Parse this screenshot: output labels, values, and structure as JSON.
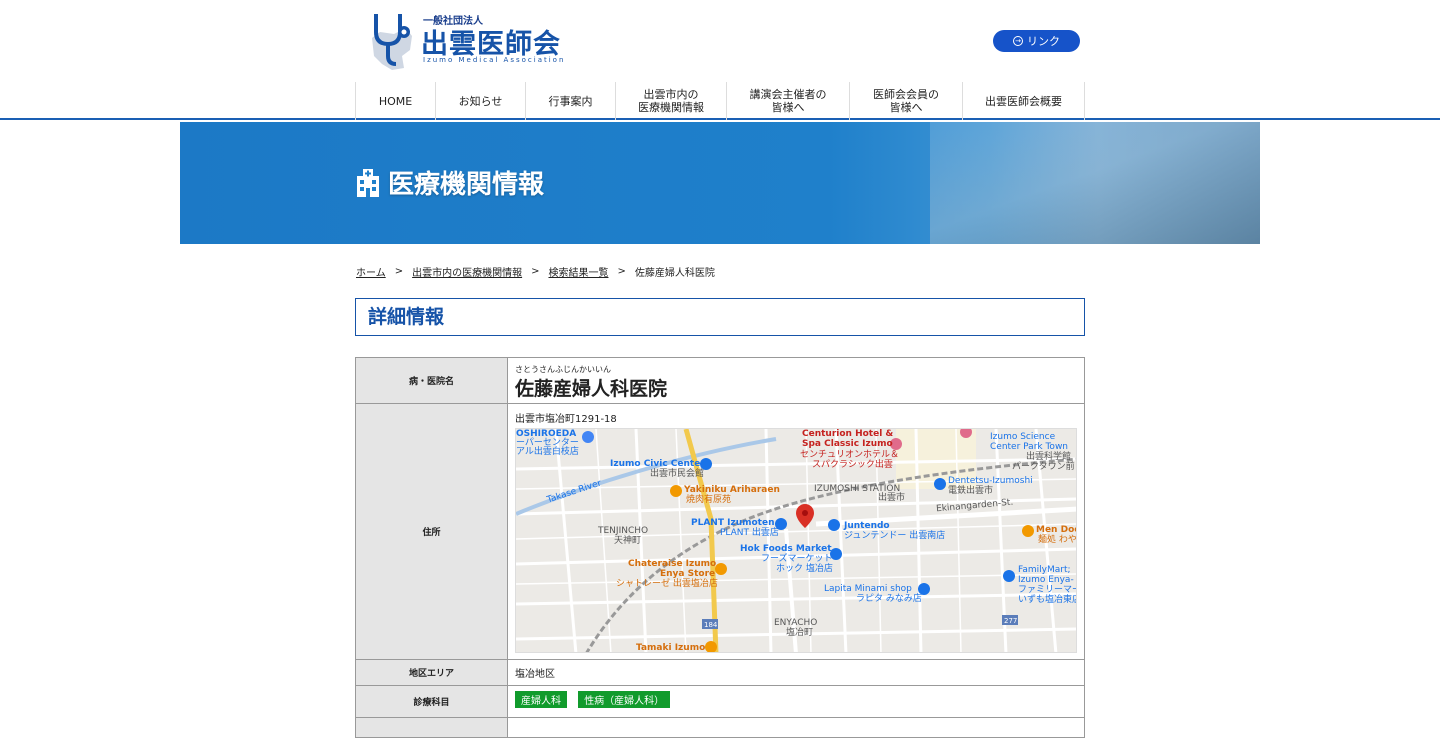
{
  "header": {
    "org_type": "一般社団法人",
    "org_name": "出雲医師会",
    "org_name_en": "Izumo Medical Association",
    "link_label": "リンク"
  },
  "nav": [
    {
      "label": "HOME",
      "width": 80
    },
    {
      "label": "お知らせ",
      "width": 90
    },
    {
      "label": "行事案内",
      "width": 90
    },
    {
      "label": "出雲市内の\n医療機関情報",
      "width": 111
    },
    {
      "label": "講演会主催者の\n皆様へ",
      "width": 123
    },
    {
      "label": "医師会会員の\n皆様へ",
      "width": 113
    },
    {
      "label": "出雲医師会概要",
      "width": 122
    }
  ],
  "banner": {
    "title": "医療機関情報"
  },
  "breadcrumb": {
    "home": "ホーム",
    "sep": ">",
    "level1": "出雲市内の医療機関情報",
    "level2": "検索結果一覧",
    "current": "佐藤産婦人科医院"
  },
  "section_title": "詳細情報",
  "detail": {
    "name_label": "病・医院名",
    "name_ruby": "さとうさんふじんかいいん",
    "name": "佐藤産婦人科医院",
    "address_label": "住所",
    "address": "出雲市塩冶町1291-18",
    "area_label": "地区エリア",
    "area": "塩冶地区",
    "dept_label": "診療科目",
    "departments": [
      "産婦人科",
      "性病（産婦人科）"
    ]
  },
  "map_labels": {
    "oshiroeda": "OSHIROEDA",
    "supercenter": "ーパーセンター",
    "supercenter2": "アル出雲白枝店",
    "civic": "Izumo Civic Center",
    "civic_jp": "出雲市民会館",
    "centurion1": "Centurion Hotel &",
    "centurion2": "Spa Classic Izumo",
    "centurion_jp1": "センチュリオンホテル＆",
    "centurion_jp2": "スパクラシック出雲",
    "science1": "Izumo Science",
    "science2": "Center Park Town",
    "science_jp1": "出雲科学館",
    "science_jp2": "パークタウン前",
    "takase": "Takase River",
    "yakiniku": "Yakiniku Ariharaen",
    "yakiniku_jp": "焼肉有原苑",
    "station": "IZUMOSHI STATION",
    "station_jp": "出雲市",
    "dentetsu": "Dentetsu-Izumoshi",
    "dentetsu_jp": "電鉄出雲市",
    "ekinan": "Ekinangarden-St.",
    "tenjincho": "TENJINCHO",
    "tenjincho_jp": "天神町",
    "plant": "PLANT Izumoten",
    "plant_jp": "PLANT 出雲店",
    "juntendo": "Juntendo",
    "juntendo_jp": "ジュンテンドー 出雲南店",
    "hok": "Hok Foods Market",
    "hok_jp1": "フーズマーケット",
    "hok_jp2": "ホック 塩冶店",
    "mendoc": "Men Doc",
    "mendoc_jp": "麺処 わや",
    "chateraise1": "Chateraise Izumo",
    "chateraise2": "Enya Store",
    "chateraise_jp": "シャトレーゼ 出雲塩冶店",
    "family1": "FamilyMart;",
    "family2": "Izumo Enya-",
    "family_jp1": "ファミリーマー",
    "family_jp2": "いずも塩冶東店",
    "lapita": "Lapita Minami shop",
    "lapita_jp": "ラピタ みなみ店",
    "enyacho": "ENYACHO",
    "enyacho_jp": "塩冶町",
    "tamaki": "Tamaki Izumo",
    "route184": "184",
    "route277": "277"
  },
  "colors": {
    "brand": "#1653a8",
    "link_button": "#1653c9",
    "tag": "#119b2c",
    "banner": "#1f80cb"
  }
}
